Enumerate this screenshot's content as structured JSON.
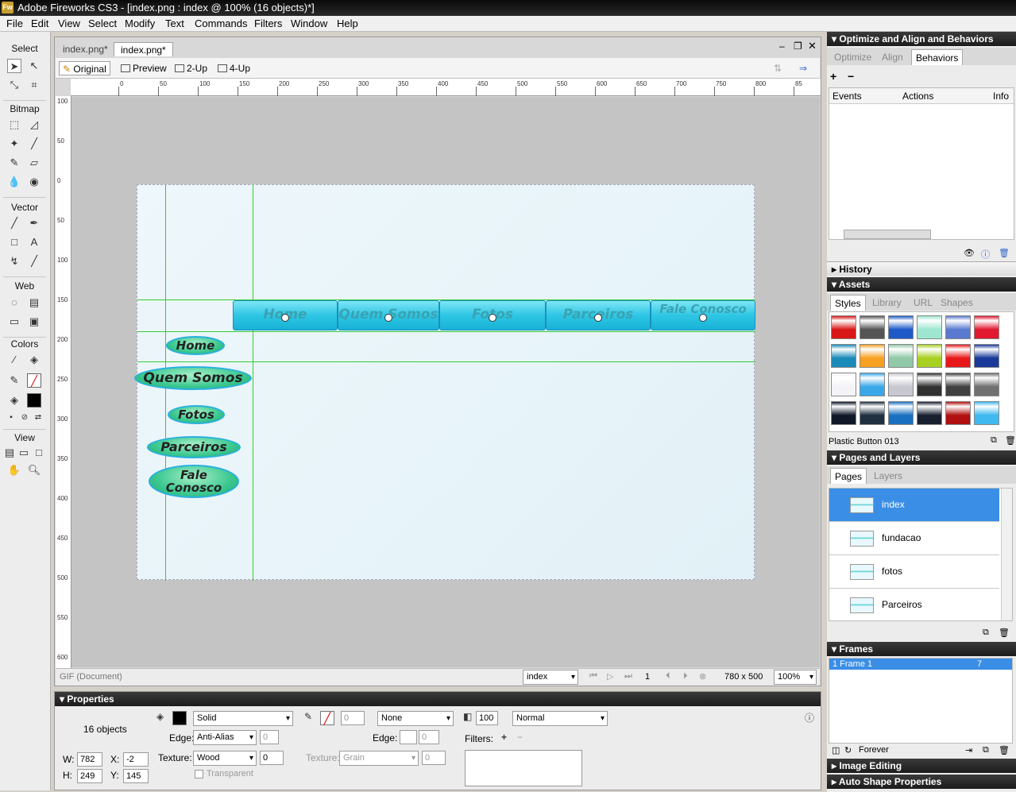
{
  "window": {
    "title": "Adobe Fireworks CS3 - [index.png : index @ 100% (16 objects)*]",
    "app_icon": "Fw"
  },
  "menu": [
    "File",
    "Edit",
    "View",
    "Select",
    "Modify",
    "Text",
    "Commands",
    "Filters",
    "Window",
    "Help"
  ],
  "tools": {
    "select": "Select",
    "bitmap": "Bitmap",
    "vector": "Vector",
    "web": "Web",
    "colors": "Colors",
    "view": "View"
  },
  "document": {
    "tabs": [
      "index.png*",
      "index.png*"
    ],
    "view_buttons": [
      "Original",
      "Preview",
      "2-Up",
      "4-Up"
    ],
    "ruler_h": [
      "0",
      "50",
      "100",
      "150",
      "200",
      "250",
      "300",
      "350",
      "400",
      "450",
      "500",
      "550",
      "600",
      "650",
      "700",
      "750",
      "800",
      "85"
    ],
    "ruler_v": [
      "100",
      "50",
      "0",
      "50",
      "100",
      "150",
      "200",
      "250",
      "300",
      "350",
      "400",
      "450",
      "500",
      "550",
      "600"
    ],
    "h_buttons": [
      "Home",
      "Quem Somos",
      "Fotos",
      "Parceiros",
      "Fale Conosco"
    ],
    "v_buttons": [
      "Home",
      "Quem Somos",
      "Fotos",
      "Parceiros",
      "Fale Conosco"
    ],
    "status": {
      "format": "GIF (Document)",
      "page": "index",
      "frame": "1",
      "size": "780 x 500",
      "zoom": "100%"
    }
  },
  "right": {
    "behaviors": {
      "title": "Optimize and Align and Behaviors",
      "tabs": [
        "Optimize",
        "Align",
        "Behaviors"
      ],
      "cols": [
        "Events",
        "Actions",
        "Info"
      ]
    },
    "history": "History",
    "assets": {
      "title": "Assets",
      "tabs": [
        "Styles",
        "Library",
        "URL",
        "Shapes"
      ],
      "selected_style": "Plastic Button 013",
      "swatches": [
        "#d81818",
        "#555555",
        "#1d5ac8",
        "#9ee6d0",
        "#5a7ad0",
        "#e01830",
        "#1a8ab8",
        "#f8a020",
        "#90c8a8",
        "#a8d020",
        "#e81818",
        "#1a3a9a",
        "#f4f4f8",
        "#3aa8e8",
        "#c8c8d0",
        "#303030",
        "#404040",
        "#707070",
        "#101828",
        "#203040",
        "#1a70c0",
        "#182030",
        "#b01010",
        "#40b8f0"
      ]
    },
    "pages_layers": {
      "title": "Pages and Layers",
      "tabs": [
        "Pages",
        "Layers"
      ],
      "pages": [
        "index",
        "fundacao",
        "fotos",
        "Parceiros"
      ]
    },
    "frames": {
      "title": "Frames",
      "row": "1   Frame 1",
      "delay": "7",
      "loop": "Forever"
    },
    "image_editing": "Image Editing",
    "auto_shape": "Auto Shape Properties"
  },
  "properties": {
    "title": "Properties",
    "count": "16 objects",
    "w": "782",
    "h": "249",
    "x": "-2",
    "y": "145",
    "fill_type": "Solid",
    "edge_label": "Edge:",
    "edge": "Anti-Alias",
    "edge_val": "0",
    "texture_label": "Texture:",
    "texture": "Wood",
    "texture_val": "0",
    "transparent": "Transparent",
    "stroke_size": "0",
    "stroke_type": "None",
    "stroke_edge_val": "0",
    "stroke_texture": "Grain",
    "stroke_texture_val": "0",
    "opacity": "100",
    "blend": "Normal",
    "filters_label": "Filters:"
  }
}
